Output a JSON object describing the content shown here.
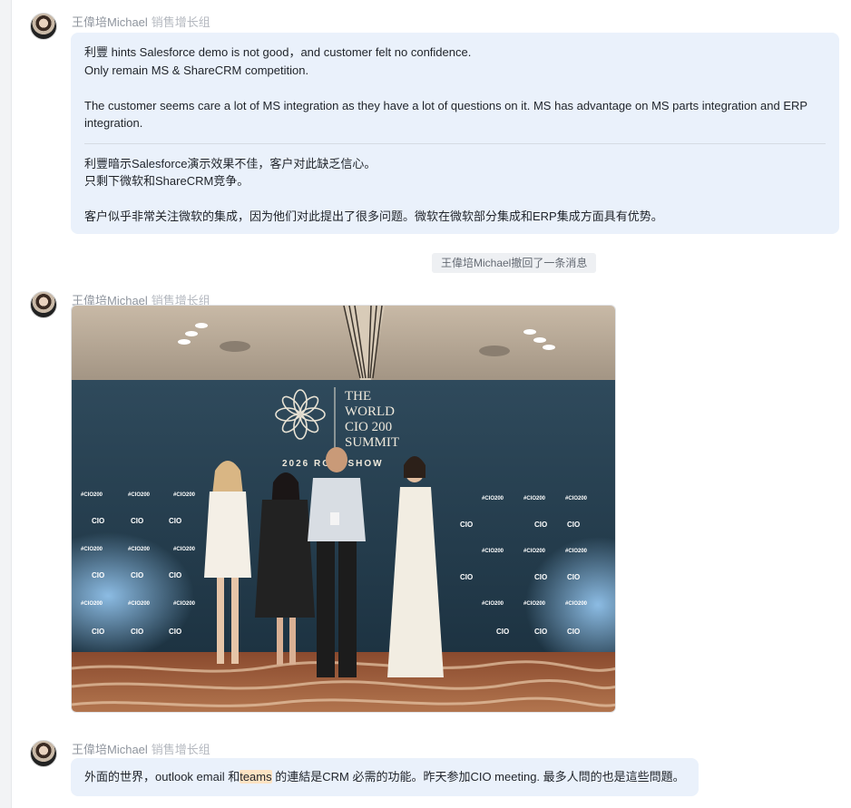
{
  "messages": [
    {
      "sender": "王偉培Michael",
      "dept": "销售增长组",
      "en_lines": [
        "利豐 hints Salesforce demo is not good，and customer felt no confidence.",
        "Only remain MS & ShareCRM competition.",
        "The customer seems care a lot of MS integration as they have a lot of questions on it. MS  has advantage on MS parts integration and ERP integration."
      ],
      "zh_lines": [
        "利豐暗示Salesforce演示效果不佳，客户对此缺乏信心。",
        "只剩下微软和ShareCRM竞争。",
        "客户似乎非常关注微软的集成，因为他们对此提出了很多问题。微软在微软部分集成和ERP集成方面具有优势。"
      ]
    },
    {
      "sender": "王偉培Michael",
      "dept": "销售增长组",
      "photo": {
        "banner_title": [
          "THE",
          "WORLD",
          "CIO 200",
          "SUMMIT"
        ],
        "banner_sub": "2026 ROADSHOW",
        "tag": "#CIO200",
        "logo": "CIO"
      }
    },
    {
      "sender": "王偉培Michael",
      "dept": "销售增长组",
      "text_before": "外面的世界，outlook email 和",
      "text_highlight": "teams",
      "text_after": " 的連結是CRM 必需的功能。昨天参加CIO meeting. 最多人問的也是這些問題。"
    }
  ],
  "recall_notice": "王偉培Michael撤回了一条消息",
  "colors": {
    "bubble": "#eaf1fb",
    "meta_text": "#8f959e",
    "highlight": "#fde3c3"
  }
}
